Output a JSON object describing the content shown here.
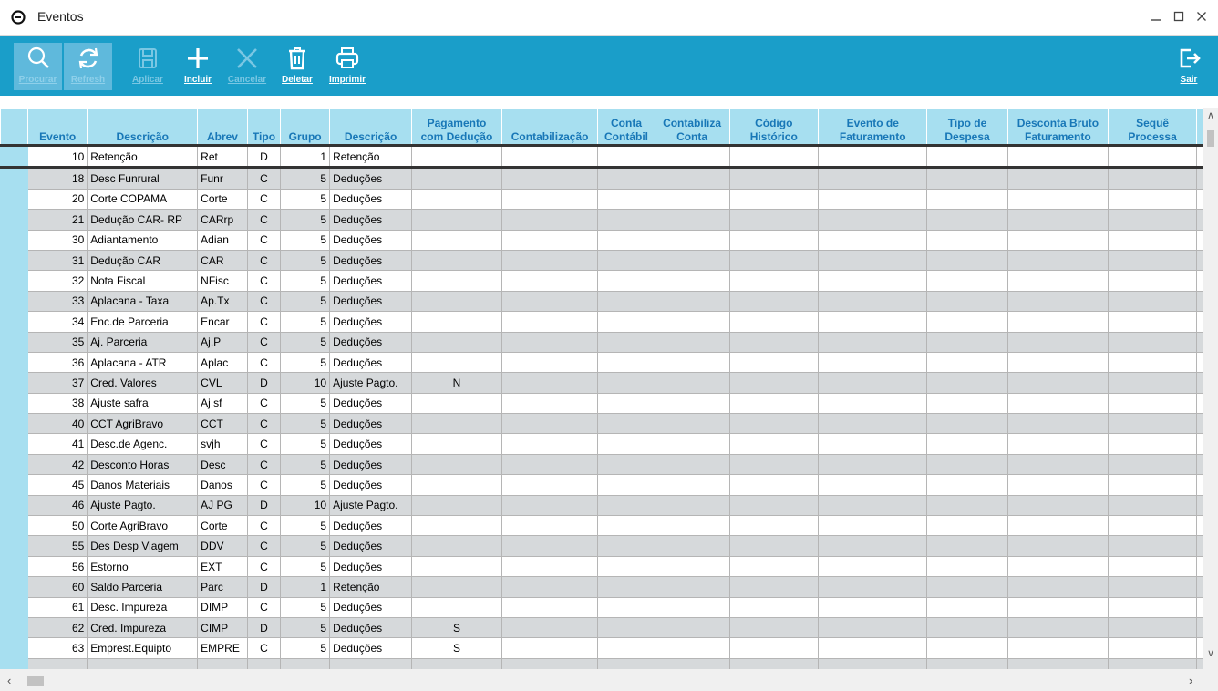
{
  "window": {
    "title": "Eventos"
  },
  "toolbar": {
    "buttons": [
      {
        "label": "Procurar",
        "icon": "search-icon",
        "state": "active"
      },
      {
        "label": "Refresh",
        "icon": "refresh-icon",
        "state": "active"
      },
      {
        "label": "Aplicar",
        "icon": "save-icon",
        "state": "disabled"
      },
      {
        "label": "Incluir",
        "icon": "plus-icon",
        "state": "enabled"
      },
      {
        "label": "Cancelar",
        "icon": "x-icon",
        "state": "disabled"
      },
      {
        "label": "Deletar",
        "icon": "trash-icon",
        "state": "enabled"
      },
      {
        "label": "Imprimir",
        "icon": "printer-icon",
        "state": "enabled"
      }
    ],
    "exit_label": "Sair"
  },
  "grid": {
    "columns": [
      [
        "",
        "Evento"
      ],
      [
        "",
        "Descrição"
      ],
      [
        "",
        "Abrev"
      ],
      [
        "",
        "Tipo"
      ],
      [
        "",
        "Grupo"
      ],
      [
        "",
        "Descrição"
      ],
      [
        "Pagamento",
        "com Dedução"
      ],
      [
        "",
        "Contabilização"
      ],
      [
        "Conta",
        "Contábil"
      ],
      [
        "Contabiliza",
        "Conta"
      ],
      [
        "Código",
        "Histórico"
      ],
      [
        "Evento de",
        "Faturamento"
      ],
      [
        "Tipo de",
        "Despesa"
      ],
      [
        "Desconta Bruto",
        "Faturamento"
      ],
      [
        "Sequê",
        "Processa"
      ]
    ],
    "rows": [
      [
        "10",
        "Retenção",
        "Ret",
        "D",
        "1",
        "Retenção",
        ""
      ],
      [
        "18",
        "Desc Funrural",
        "Funr",
        "C",
        "5",
        "Deduções",
        ""
      ],
      [
        "20",
        "Corte COPAMA",
        "Corte",
        "C",
        "5",
        "Deduções",
        ""
      ],
      [
        "21",
        "Dedução CAR- RP",
        "CARrp",
        "C",
        "5",
        "Deduções",
        ""
      ],
      [
        "30",
        "Adiantamento",
        "Adian",
        "C",
        "5",
        "Deduções",
        ""
      ],
      [
        "31",
        "Dedução CAR",
        "CAR",
        "C",
        "5",
        "Deduções",
        ""
      ],
      [
        "32",
        "Nota Fiscal",
        "NFisc",
        "C",
        "5",
        "Deduções",
        ""
      ],
      [
        "33",
        "Aplacana - Taxa",
        "Ap.Tx",
        "C",
        "5",
        "Deduções",
        ""
      ],
      [
        "34",
        "Enc.de Parceria",
        "Encar",
        "C",
        "5",
        "Deduções",
        ""
      ],
      [
        "35",
        "Aj. Parceria",
        "Aj.P",
        "C",
        "5",
        "Deduções",
        ""
      ],
      [
        "36",
        "Aplacana - ATR",
        "Aplac",
        "C",
        "5",
        "Deduções",
        ""
      ],
      [
        "37",
        "Cred. Valores",
        "CVL",
        "D",
        "10",
        "Ajuste Pagto.",
        "N"
      ],
      [
        "38",
        "Ajuste safra",
        "Aj sf",
        "C",
        "5",
        "Deduções",
        ""
      ],
      [
        "40",
        "CCT AgriBravo",
        "CCT",
        "C",
        "5",
        "Deduções",
        ""
      ],
      [
        "41",
        "Desc.de Agenc.",
        "svjh",
        "C",
        "5",
        "Deduções",
        ""
      ],
      [
        "42",
        "Desconto Horas",
        "Desc",
        "C",
        "5",
        "Deduções",
        ""
      ],
      [
        "45",
        "Danos Materiais",
        "Danos",
        "C",
        "5",
        "Deduções",
        ""
      ],
      [
        "46",
        "Ajuste Pagto.",
        "AJ PG",
        "D",
        "10",
        "Ajuste Pagto.",
        ""
      ],
      [
        "50",
        "Corte AgriBravo",
        "Corte",
        "C",
        "5",
        "Deduções",
        ""
      ],
      [
        "55",
        "Des Desp Viagem",
        "DDV",
        "C",
        "5",
        "Deduções",
        ""
      ],
      [
        "56",
        "Estorno",
        "EXT",
        "C",
        "5",
        "Deduções",
        ""
      ],
      [
        "60",
        "Saldo Parceria",
        "Parc",
        "D",
        "1",
        "Retenção",
        ""
      ],
      [
        "61",
        "Desc. Impureza",
        "DIMP",
        "C",
        "5",
        "Deduções",
        ""
      ],
      [
        "62",
        "Cred. Impureza",
        "CIMP",
        "D",
        "5",
        "Deduções",
        "S"
      ],
      [
        "63",
        "Emprest.Equipto",
        "EMPRE",
        "C",
        "5",
        "Deduções",
        "S"
      ]
    ]
  },
  "colors": {
    "toolbar_bg": "#1a9ec9",
    "header_bg": "#a7dff0",
    "header_text": "#1877b7",
    "row_alt": "#d6d9db"
  }
}
